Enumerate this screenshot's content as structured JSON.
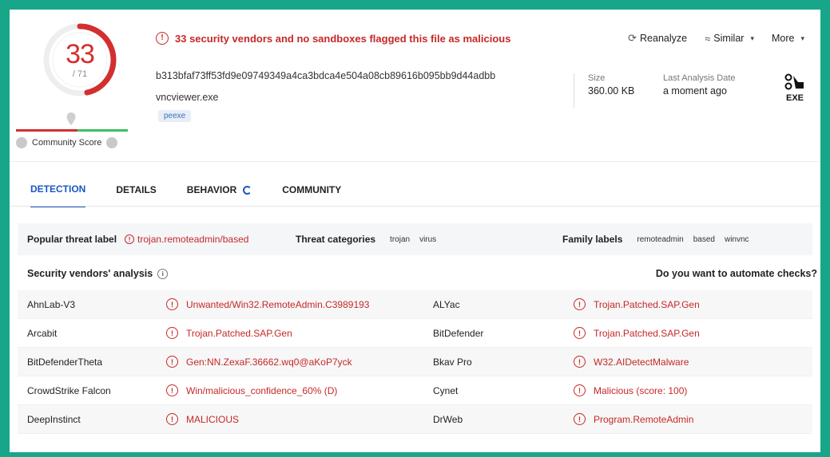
{
  "score": {
    "detections": "33",
    "total": "/ 71",
    "community_label": "Community Score"
  },
  "alert": {
    "text": "33 security vendors and no sandboxes flagged this file as malicious"
  },
  "file": {
    "hash": "b313bfaf73ff53fd9e09749349a4ca3bdca4e504a08cb89616b095bb9d44adbb",
    "name": "vncviewer.exe",
    "tag": "peexe",
    "size_label": "Size",
    "size_value": "360.00 KB",
    "date_label": "Last Analysis Date",
    "date_value": "a moment ago",
    "type_icon_text": "EXE"
  },
  "actions": {
    "reanalyze": "Reanalyze",
    "similar": "Similar",
    "more": "More"
  },
  "tabs": [
    {
      "label": "DETECTION"
    },
    {
      "label": "DETAILS"
    },
    {
      "label": "BEHAVIOR"
    },
    {
      "label": "COMMUNITY"
    }
  ],
  "threat": {
    "popular_label": "Popular threat label",
    "popular_value": "trojan.remoteadmin/based",
    "categories_label": "Threat categories",
    "categories": [
      "trojan",
      "virus"
    ],
    "family_label": "Family labels",
    "families": [
      "remoteadmin",
      "based",
      "winvnc"
    ]
  },
  "vendors_heading": "Security vendors' analysis",
  "automate_text": "Do you want to automate checks?",
  "vendors": [
    {
      "name1": "AhnLab-V3",
      "result1": "Unwanted/Win32.RemoteAdmin.C3989193",
      "name2": "ALYac",
      "result2": "Trojan.Patched.SAP.Gen"
    },
    {
      "name1": "Arcabit",
      "result1": "Trojan.Patched.SAP.Gen",
      "name2": "BitDefender",
      "result2": "Trojan.Patched.SAP.Gen"
    },
    {
      "name1": "BitDefenderTheta",
      "result1": "Gen:NN.ZexaF.36662.wq0@aKoP7yck",
      "name2": "Bkav Pro",
      "result2": "W32.AIDetectMalware"
    },
    {
      "name1": "CrowdStrike Falcon",
      "result1": "Win/malicious_confidence_60% (D)",
      "name2": "Cynet",
      "result2": "Malicious (score: 100)"
    },
    {
      "name1": "DeepInstinct",
      "result1": "MALICIOUS",
      "name2": "DrWeb",
      "result2": "Program.RemoteAdmin"
    }
  ],
  "colors": {
    "malicious": "#c62828",
    "accent": "#1a56c4",
    "frame": "#17a68a"
  },
  "score_fraction": 0.465
}
